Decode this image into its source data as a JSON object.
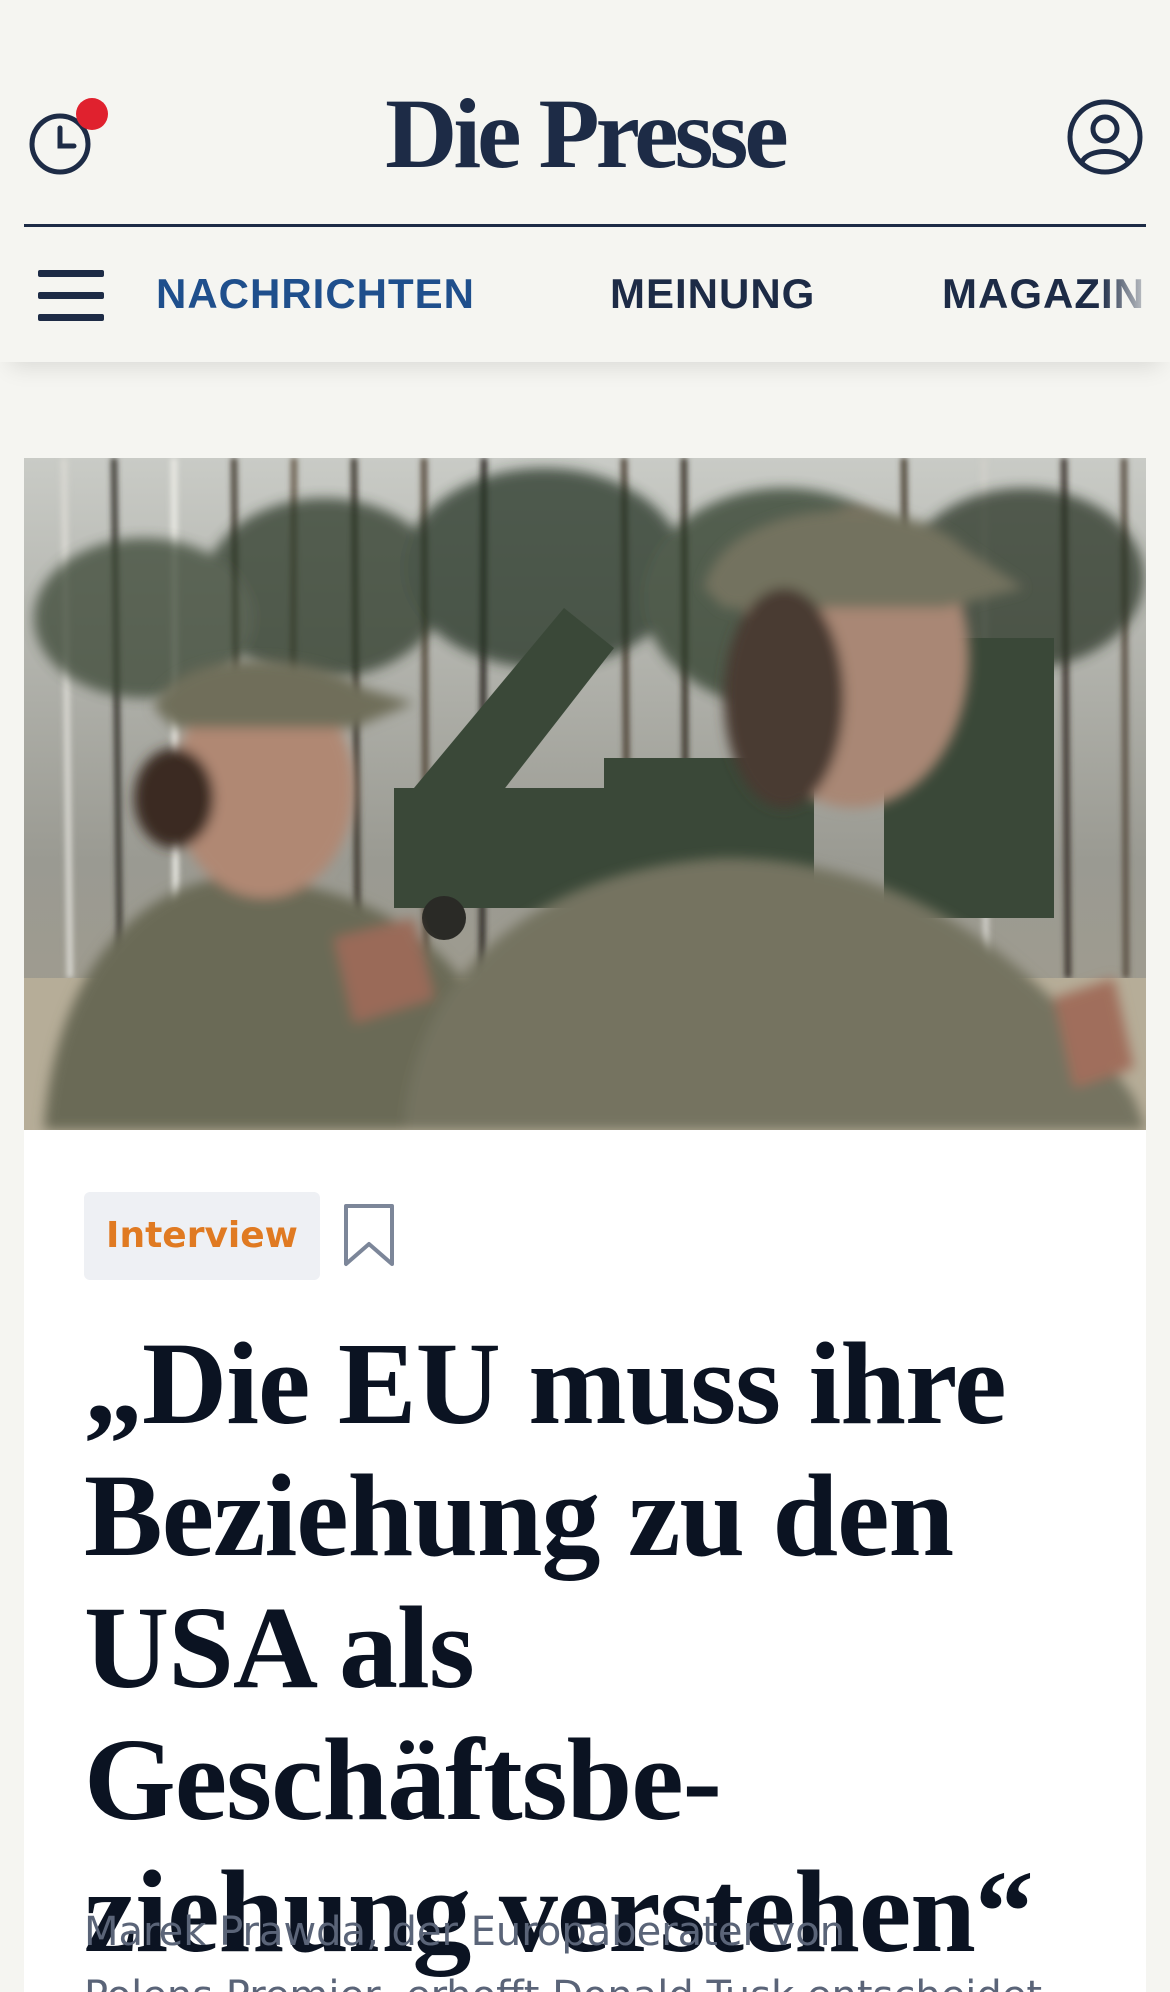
{
  "header": {
    "logo": "Die Presse",
    "notification_color": "#e0212e",
    "icons": {
      "history": "clock-history-icon",
      "account": "user-account-icon",
      "menu": "hamburger-menu-icon"
    }
  },
  "nav": {
    "items": [
      {
        "label": "NACHRICHTEN",
        "active": true
      },
      {
        "label": "MEINUNG",
        "active": false
      },
      {
        "label": "MAGAZIN",
        "active": false
      }
    ]
  },
  "article": {
    "category": "Interview",
    "headline_lines": [
      "„Die EU muss ihre",
      "Beziehung zu den",
      "USA als Geschäftsbe-",
      "ziehung verstehen“"
    ],
    "lead_line1": "Marek Prawda, der Europaberater von",
    "lead_line2": "Polens Premier, erhofft Donald Tusk entscheidet",
    "bookmark_icon": "bookmark-icon"
  },
  "colors": {
    "brand": "#1d2b46",
    "active_nav": "#1f4f8c",
    "category": "#e07a22",
    "background": "#f5f5f1"
  }
}
